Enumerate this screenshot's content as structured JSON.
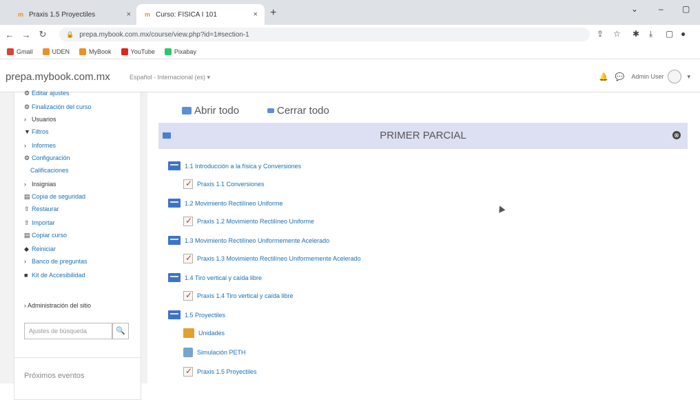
{
  "browser": {
    "tabs": [
      {
        "label": "Praxis 1.5 Proyectiles",
        "active": false
      },
      {
        "label": "Curso: FÍSICA I 101",
        "active": true
      }
    ],
    "url": "prepa.mybook.com.mx/course/view.php?id=1#section-1",
    "bookmarks": [
      "Gmail",
      "UDEN",
      "MyBook",
      "YouTube",
      "Pixabay"
    ],
    "window_controls": [
      "⌄",
      "–",
      "▢"
    ]
  },
  "navbar": {
    "brand": "prepa.mybook.com.mx",
    "language": "Español - Internacional (es) ▾",
    "user": "Admin User"
  },
  "sidebar": {
    "items": [
      {
        "icon": "⚙",
        "label": "Editar ajustes"
      },
      {
        "icon": "⚙",
        "label": "Finalización del curso"
      },
      {
        "icon": "›",
        "label": "Usuarios"
      },
      {
        "icon": "▼",
        "label": "Filtros"
      },
      {
        "icon": "›",
        "label": "Informes"
      },
      {
        "icon": "⚙",
        "label": "Configuración"
      },
      {
        "icon": "",
        "label": "Calificaciones"
      },
      {
        "icon": "›",
        "label": "Insignias"
      },
      {
        "icon": "▤",
        "label": "Copia de seguridad"
      },
      {
        "icon": "⇧",
        "label": "Restaurar"
      },
      {
        "icon": "⇧",
        "label": "Importar"
      },
      {
        "icon": "▤",
        "label": "Copiar curso"
      },
      {
        "icon": "◆",
        "label": "Reiniciar"
      },
      {
        "icon": "›",
        "label": "Banco de preguntas"
      },
      {
        "icon": "■",
        "label": "Kit de Accesibilidad"
      }
    ],
    "site_admin": "› Administración del sitio",
    "search_placeholder": "Ajustes de búsqueda",
    "events_title": "Próximos eventos"
  },
  "main": {
    "open_all": "Abrir todo",
    "close_all": "Cerrar todo",
    "section_title": "PRIMER PARCIAL",
    "activities": [
      {
        "type": "label",
        "text": "1.1 Introducción a la física y Conversiones"
      },
      {
        "type": "quiz",
        "text": "Praxis 1.1 Conversiones"
      },
      {
        "type": "label",
        "text": "1.2 Movimiento Rectilíneo Uniforme"
      },
      {
        "type": "quiz",
        "text": "Praxis 1.2 Movimiento Rectilíneo Uniforme"
      },
      {
        "type": "label",
        "text": "1.3 Movimiento Rectilíneo Uniformemente Acelerado"
      },
      {
        "type": "quiz",
        "text": "Praxis 1.3 Movimiento Rectilíneo Uniformemente Acelerado"
      },
      {
        "type": "label",
        "text": "1.4 Tiro vertical y caída libre"
      },
      {
        "type": "quiz",
        "text": "Praxis 1.4 Tiro vertical y caída libre"
      },
      {
        "type": "label",
        "text": "1.5 Proyectiles"
      },
      {
        "type": "folder",
        "text": "Unidades"
      },
      {
        "type": "sim",
        "text": "Simulación PETH"
      },
      {
        "type": "quiz",
        "text": "Praxis 1.5 Proyectiles"
      }
    ]
  }
}
